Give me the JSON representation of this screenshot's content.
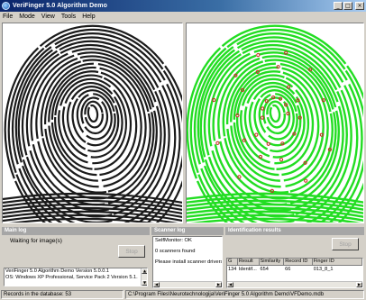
{
  "window": {
    "title": "VeriFinger 5.0 Algorithm Demo",
    "minimize_glyph": "_",
    "maximize_glyph": "□",
    "close_glyph": "×"
  },
  "menu": [
    "File",
    "Mode",
    "View",
    "Tools",
    "Help"
  ],
  "main_log": {
    "header": "Main log",
    "status": "Waiting for image(s)",
    "button": "Stop",
    "lines": [
      "VeriFinger 5.0 Algorithm Demo   Version 5.0.0.1",
      "OS: Windows XP Professional, Service Pack 2 Version 5.1."
    ]
  },
  "scanner_log": {
    "header": "Scanner log",
    "lines": [
      "SelfMonitor: OK",
      "0 scanners found",
      "Please install scanner drivers f"
    ]
  },
  "identification": {
    "header": "Identification results",
    "button": "Stop",
    "columns": [
      "G",
      "Result",
      "Similarity",
      "Record ID",
      "Finger ID"
    ],
    "rows": [
      [
        "134",
        "Identif...",
        "654",
        "66",
        "013_8_1"
      ]
    ]
  },
  "status": {
    "records": "Records in the database: 53",
    "path": "C:\\Program Files\\Neurotechnologija\\VeriFinger 5.0 Algorithm Demo\\VFDemo.mdb"
  },
  "colors": {
    "titlebar": "#0a246a",
    "ridge_left": "#1a1a1a",
    "ridge_right": "#22dd22",
    "minutiae": "#cc2222"
  },
  "icons": {
    "app": "verifinger-app-icon",
    "scroll_up": "▲",
    "scroll_down": "▼",
    "scroll_left": "◀",
    "scroll_right": "▶"
  }
}
